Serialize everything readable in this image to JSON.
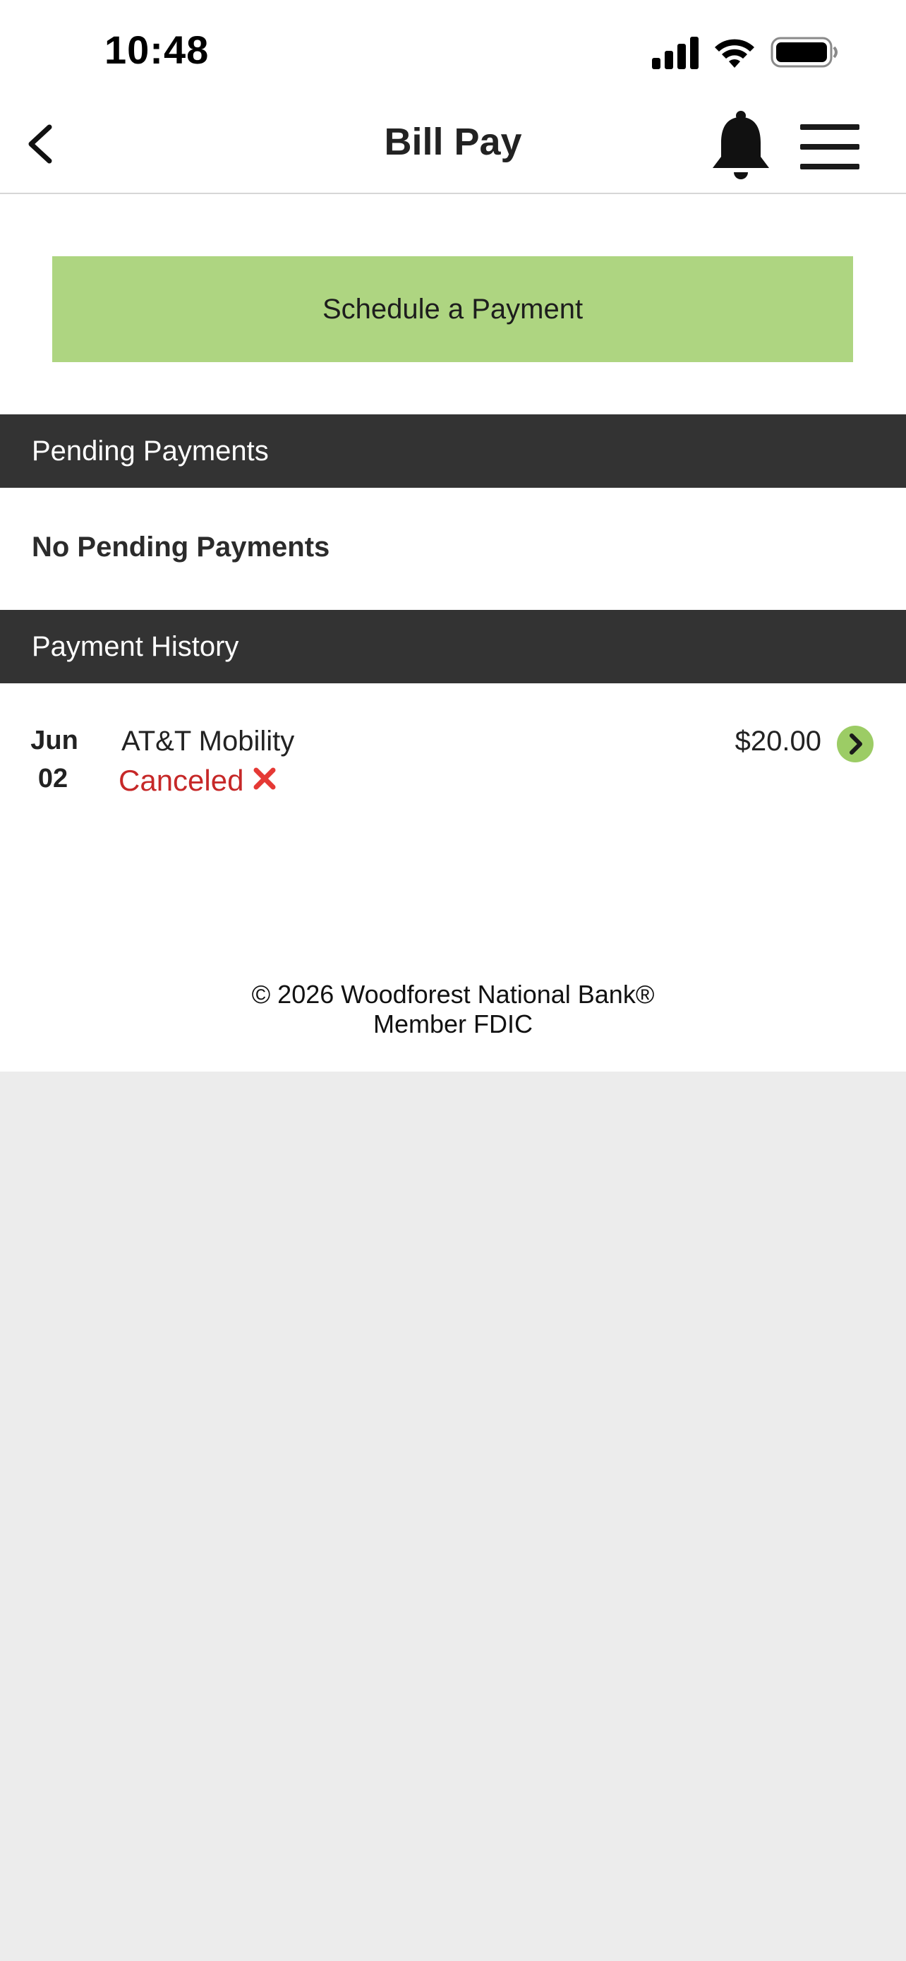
{
  "status_bar": {
    "time": "10:48",
    "icons": [
      "cellular-signal-icon",
      "wifi-icon",
      "battery-icon"
    ]
  },
  "header": {
    "title": "Bill Pay",
    "icons": [
      "back-chevron-icon",
      "bell-icon",
      "hamburger-menu-icon"
    ]
  },
  "actions": {
    "schedule_label": "Schedule a Payment"
  },
  "pending": {
    "title": "Pending Payments",
    "empty_text": "No Pending Payments"
  },
  "history": {
    "title": "Payment History",
    "items": [
      {
        "month": "Jun",
        "day": "02",
        "payee": "AT&T Mobility",
        "status": "Canceled",
        "amount": "$20.00"
      }
    ]
  },
  "footer": {
    "copyright": "© 2026 Woodforest National Bank®",
    "member": "Member FDIC"
  },
  "colors": {
    "accent": "#aed581",
    "section_header": "#333333",
    "canceled": "#c62828",
    "cancel_icon": "#e53935",
    "page_bg": "#ececec"
  }
}
